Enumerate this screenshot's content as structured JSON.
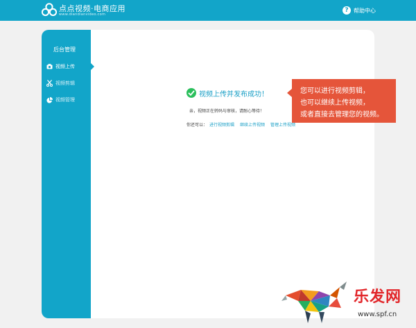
{
  "header": {
    "logo_title": "点点视频·电商应用",
    "logo_url": "www.diandianvideo.com",
    "help_label": "帮助中心"
  },
  "sidebar": {
    "heading": "后台管理",
    "items": [
      {
        "label": "视频上传",
        "icon": "camera-icon",
        "active": true
      },
      {
        "label": "视频剪辑",
        "icon": "scissors-icon",
        "active": false
      },
      {
        "label": "视频管理",
        "icon": "pie-chart-icon",
        "active": false
      }
    ]
  },
  "main": {
    "success_title": "视频上传并发布成功！",
    "notice": "亲，视频正在转码与审核，请耐心等待！",
    "actions_label": "你还可以：",
    "links": [
      "进行视频剪辑",
      "继续上传视频",
      "管理上传视频"
    ]
  },
  "tip": {
    "lines": [
      "您可以进行视频剪辑，",
      "也可以继续上传视频，",
      "或者直接去管理您的视频。"
    ]
  },
  "watermark": {
    "text": "乐发网",
    "url": "www.spf.cn"
  },
  "colors": {
    "brand": "#12a5c9",
    "success": "#2bbf5c",
    "tip": "#e5553a",
    "link": "#1a9fc6"
  }
}
